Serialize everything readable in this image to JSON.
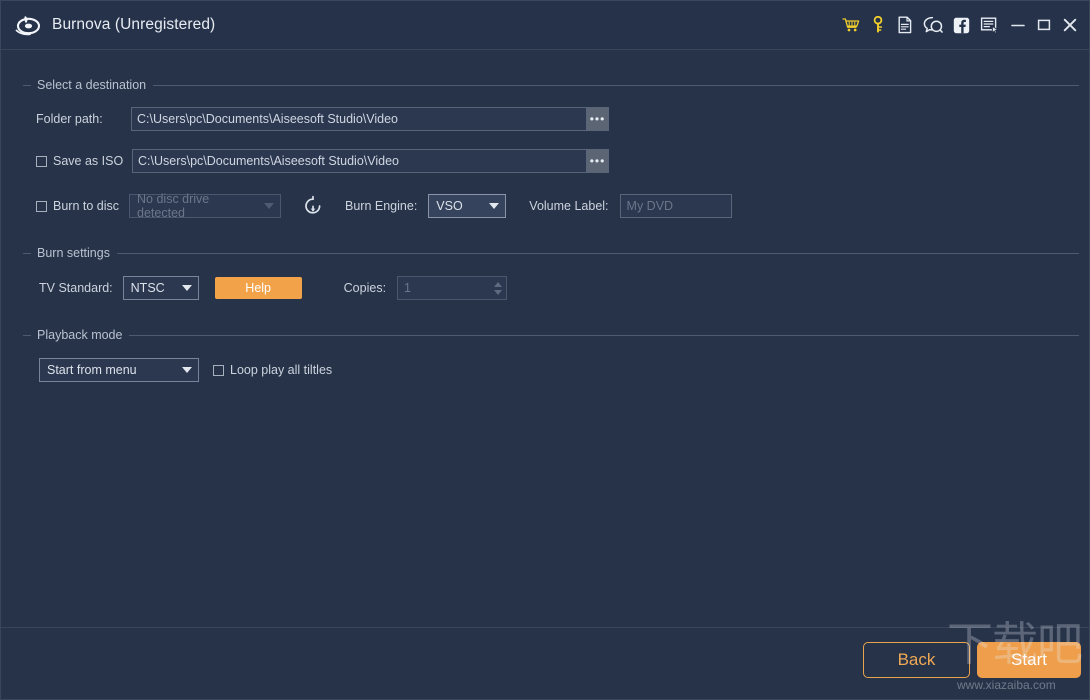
{
  "window": {
    "title": "Burnova (Unregistered)",
    "logo_icon": "burnova-disc-logo",
    "titlebar_actions": [
      {
        "name": "cart-icon",
        "label": "Buy"
      },
      {
        "name": "key-icon",
        "label": "Register"
      },
      {
        "name": "document-icon",
        "label": "Help document"
      },
      {
        "name": "chat-icon",
        "label": "Support"
      },
      {
        "name": "facebook-icon",
        "label": "Facebook"
      },
      {
        "name": "feedback-icon",
        "label": "Feedback"
      }
    ],
    "window_controls": [
      {
        "name": "minimize-button",
        "label": "Minimize"
      },
      {
        "name": "maximize-button",
        "label": "Maximize"
      },
      {
        "name": "close-button",
        "label": "Close"
      }
    ]
  },
  "destination": {
    "group_title": "Select a destination",
    "folder_path_label": "Folder path:",
    "folder_path_value": "C:\\Users\\pc\\Documents\\Aiseesoft Studio\\Video",
    "folder_browse_label": "•••",
    "save_as_iso_label": "Save as ISO",
    "save_as_iso_checked": false,
    "iso_path_value": "C:\\Users\\pc\\Documents\\Aiseesoft Studio\\Video",
    "iso_browse_label": "•••",
    "burn_to_disc_label": "Burn to disc",
    "burn_to_disc_checked": false,
    "disc_drive_value": "No disc drive detected",
    "refresh_icon": "refresh-icon",
    "burn_engine_label": "Burn Engine:",
    "burn_engine_value": "VSO",
    "volume_label_label": "Volume Label:",
    "volume_label_placeholder": "My DVD",
    "volume_label_value": ""
  },
  "burn_settings": {
    "group_title": "Burn settings",
    "tv_standard_label": "TV Standard:",
    "tv_standard_value": "NTSC",
    "help_label": "Help",
    "copies_label": "Copies:",
    "copies_value": "1"
  },
  "playback": {
    "group_title": "Playback mode",
    "mode_value": "Start from menu",
    "loop_label": "Loop play all tiltles",
    "loop_checked": false
  },
  "footer": {
    "back_label": "Back",
    "start_label": "Start"
  },
  "watermark": {
    "cjk_text": "下载吧",
    "url_text": "www.xiazaiba.com"
  },
  "colors": {
    "background": "#263348",
    "titlebar": "#25324a",
    "accent_orange": "#ef9f4b",
    "help_orange": "#f2a34a",
    "border": "#4d5a72",
    "text": "#ccd3de",
    "muted_text": "#6b7689",
    "cart_yellow": "#f5d02a"
  }
}
